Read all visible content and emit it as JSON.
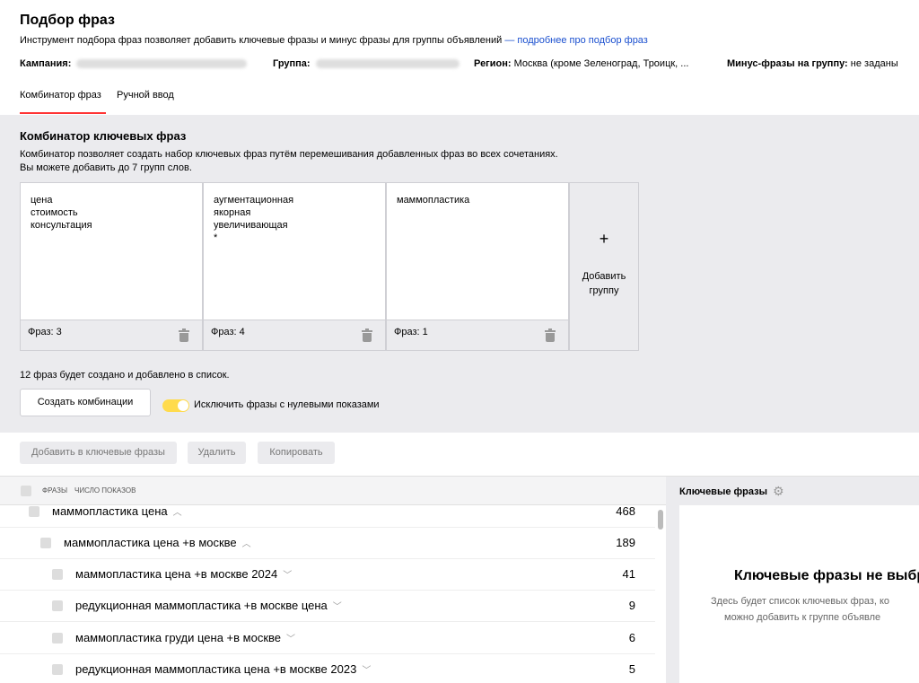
{
  "header": {
    "title": "Подбор фраз",
    "description": "Инструмент подбора фраз позволяет добавить ключевые фразы и минус фразы для группы объявлений",
    "more_link": "— подробнее про подбор фраз",
    "campaign_label": "Кампания:",
    "group_label": "Группа:",
    "region_label": "Регион:",
    "region_value": "Москва (кроме Зеленоград, Троицк, ...",
    "minus_label": "Минус-фразы на группу:",
    "minus_value": "не заданы"
  },
  "tabs": [
    {
      "label": "Комбинатор фраз",
      "active": true
    },
    {
      "label": "Ручной ввод",
      "active": false
    }
  ],
  "combinator": {
    "title": "Комбинатор ключевых фраз",
    "desc_line1": "Комбинатор позволяет создать набор ключевых фраз путём перемешивания добавленных фраз во всех сочетаниях.",
    "desc_line2": "Вы можете добавить до 7 групп слов.",
    "groups": [
      {
        "words": "цена\nстоимость\nконсультация",
        "count": "Фраз: 3"
      },
      {
        "words": "аугментационная\nякорная\nувеличивающая\n*",
        "count": "Фраз: 4"
      },
      {
        "words": "маммопластика",
        "count": "Фраз: 1"
      }
    ],
    "add_plus": "+",
    "add_label_1": "Добавить",
    "add_label_2": "группу",
    "summary": "12 фраз будет создано и добавлено в список.",
    "create_button": "Создать комбинации",
    "toggle_label": "Исключить фразы с нулевыми показами",
    "toggle_on": true
  },
  "toolbar": {
    "add_to_keywords": "Добавить в ключевые фразы",
    "delete": "Удалить",
    "copy": "Копировать"
  },
  "list": {
    "col_phrases": "ФРАЗЫ",
    "col_shows": "ЧИСЛО ПОКАЗОВ",
    "rows": [
      {
        "text": "маммопластика цена",
        "chevron": "up",
        "value": "468"
      },
      {
        "text": "маммопластика цена +в москве",
        "chevron": "up",
        "value": "189"
      },
      {
        "text": "маммопластика цена +в москве 2024",
        "chevron": "down",
        "value": "41"
      },
      {
        "text": "редукционная маммопластика +в москве цена",
        "chevron": "down",
        "value": "9"
      },
      {
        "text": "маммопластика груди цена +в москве",
        "chevron": "down",
        "value": "6"
      },
      {
        "text": "редукционная маммопластика цена +в москве 2023",
        "chevron": "down",
        "value": "5"
      }
    ]
  },
  "right_panel": {
    "title": "Ключевые фразы",
    "gear_icon": "gear-icon",
    "empty_title": "Ключевые фразы не выбран",
    "empty_desc_1": "Здесь будет список ключевых фраз, ко",
    "empty_desc_2": "можно добавить к группе объявле"
  },
  "colors": {
    "accent_red": "#ff3333",
    "link_blue": "#1a4fcf",
    "toggle_yellow": "#ffdb4d",
    "panel_gray": "#ebebee"
  }
}
